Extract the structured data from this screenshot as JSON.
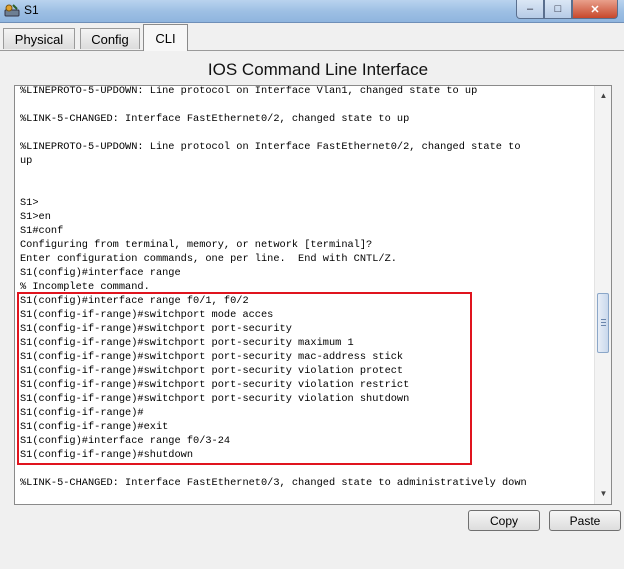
{
  "window": {
    "title": "S1",
    "controls": {
      "minimize": "–",
      "maximize": "□",
      "close": "✕"
    },
    "icon": "router-icon"
  },
  "tabs": [
    {
      "label": "Physical",
      "active": false
    },
    {
      "label": "Config",
      "active": false
    },
    {
      "label": "CLI",
      "active": true
    }
  ],
  "cli": {
    "heading": "IOS Command Line Interface",
    "lines": [
      "%LINEPROTO-5-UPDOWN: Line protocol on Interface Vlan1, changed state to up",
      "",
      "%LINK-5-CHANGED: Interface FastEthernet0/2, changed state to up",
      "",
      "%LINEPROTO-5-UPDOWN: Line protocol on Interface FastEthernet0/2, changed state to",
      "up",
      "",
      "",
      "S1>",
      "S1>en",
      "S1#conf",
      "Configuring from terminal, memory, or network [terminal]?",
      "Enter configuration commands, one per line.  End with CNTL/Z.",
      "S1(config)#interface range",
      "% Incomplete command.",
      "S1(config)#interface range f0/1, f0/2",
      "S1(config-if-range)#switchport mode acces",
      "S1(config-if-range)#switchport port-security",
      "S1(config-if-range)#switchport port-security maximum 1",
      "S1(config-if-range)#switchport port-security mac-address stick",
      "S1(config-if-range)#switchport port-security violation protect",
      "S1(config-if-range)#switchport port-security violation restrict",
      "S1(config-if-range)#switchport port-security violation shutdown",
      "S1(config-if-range)#",
      "S1(config-if-range)#exit",
      "S1(config)#interface range f0/3-24",
      "S1(config-if-range)#shutdown",
      "",
      "%LINK-5-CHANGED: Interface FastEthernet0/3, changed state to administratively down"
    ]
  },
  "buttons": {
    "copy": "Copy",
    "paste": "Paste"
  },
  "colors": {
    "highlight": "#e0141e",
    "titlebar": "#9ec0e4"
  }
}
